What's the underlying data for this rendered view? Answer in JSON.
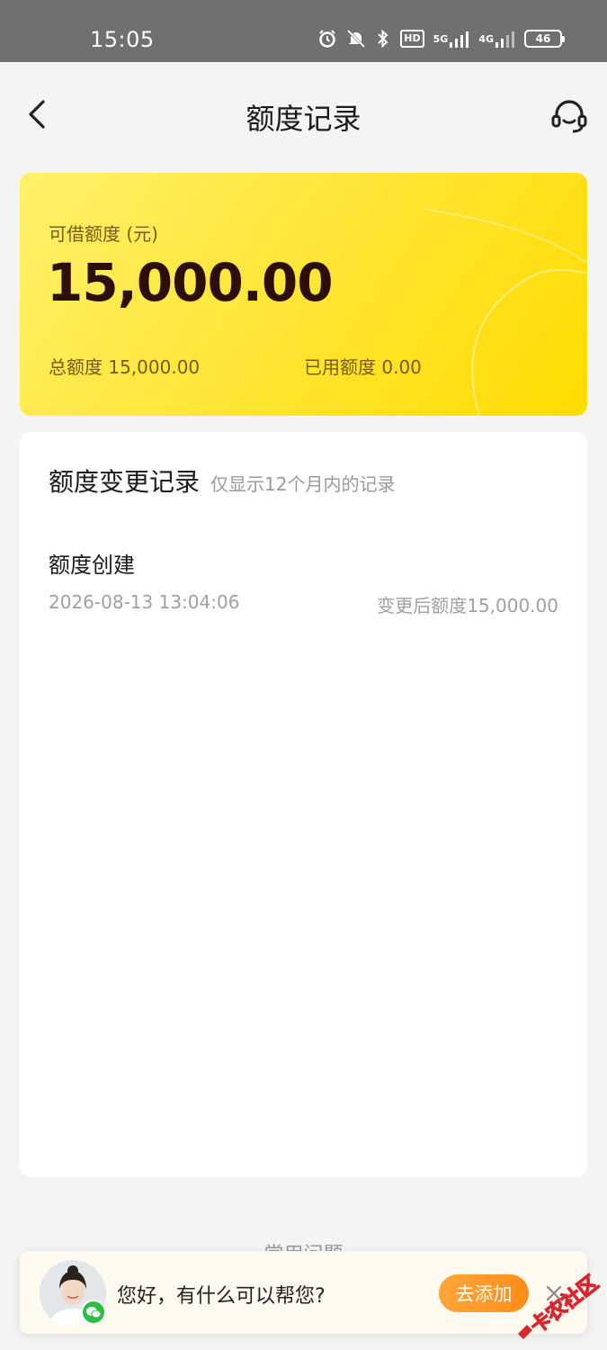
{
  "status_bar": {
    "time": "15:05",
    "icons": [
      "alarm-icon",
      "mute-icon",
      "bluetooth-icon",
      "hd-icon",
      "signal-5g-icon",
      "signal-4g-icon",
      "battery-icon"
    ],
    "hd_label": "HD",
    "net_5g": "5G",
    "net_4g": "4G",
    "battery": "46"
  },
  "nav": {
    "title": "额度记录",
    "back_icon": "chevron-left-icon",
    "service_icon": "headset-icon"
  },
  "quota_card": {
    "label": "可借额度 (元)",
    "amount": "15,000.00",
    "total": "总额度 15,000.00",
    "used": "已用额度 0.00",
    "colors": {
      "start": "#fff06a",
      "end": "#ffdc00",
      "text": "#7a5a17",
      "amount": "#2d0f0a"
    }
  },
  "records": {
    "title": "额度变更记录",
    "hint": "仅显示12个月内的记录",
    "items": [
      {
        "name": "额度创建",
        "time": "2026-08-13 13:04:06",
        "after": "变更后额度15,000.00"
      }
    ]
  },
  "faq": {
    "title": "常用问题"
  },
  "chat_banner": {
    "message": "您好，有什么可以帮您?",
    "add_label": "去添加",
    "accent": "#ff9a2a"
  },
  "watermark": {
    "text": "卡农社区"
  }
}
